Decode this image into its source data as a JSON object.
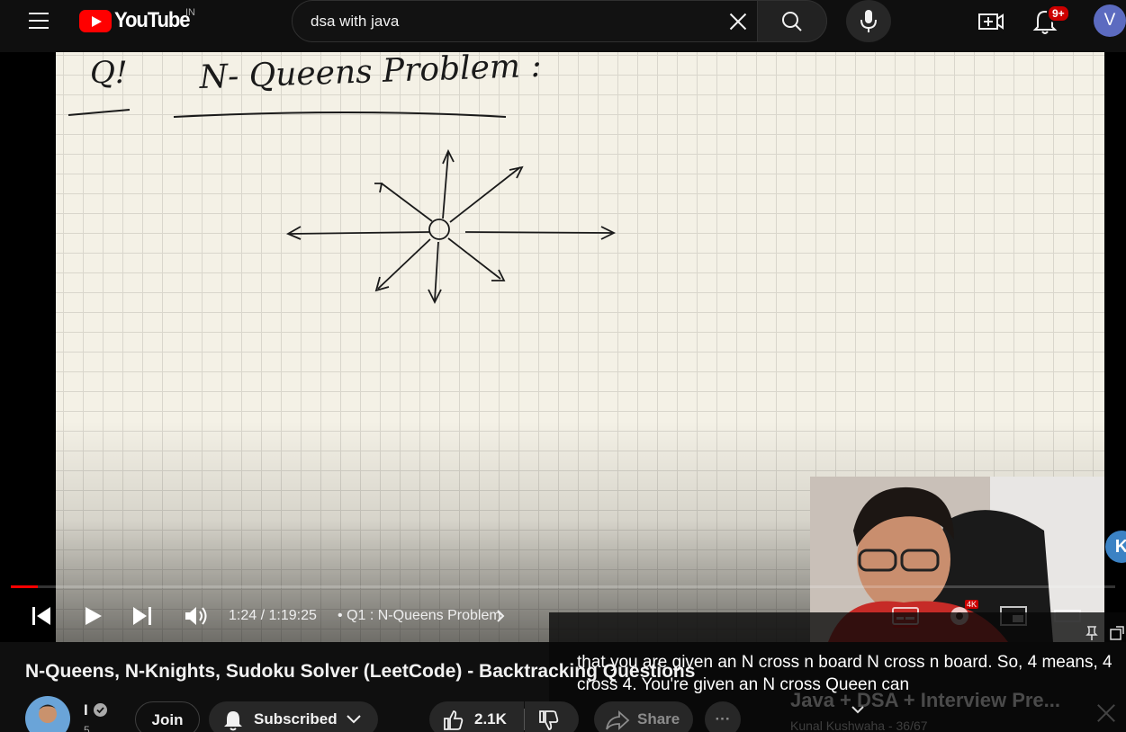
{
  "masthead": {
    "logo_text": "YouTube",
    "region": "IN",
    "search_value": "dsa with java",
    "notification_count": "9+",
    "avatar_letter": "V"
  },
  "whiteboard": {
    "label": "Q!",
    "heading": "N- Queens Problem :"
  },
  "player": {
    "time": "1:24 / 1:19:25",
    "chapter_separator": "•",
    "chapter": "Q1 : N-Queens Problem",
    "progress_fraction": 0.0018,
    "settings_badge": "4K",
    "side_badge_letter": "K"
  },
  "captions": {
    "text": "that you are given an N cross n board N cross n board. So, 4 means, 4\ncross 4. You're given an N cross Queen can"
  },
  "video": {
    "title": "N-Queens, N-Knights, Sudoku Solver (LeetCode) - Backtracking Questions",
    "channel_name": "I",
    "subscriber_count": "5",
    "join_label": "Join",
    "subscribed_label": "Subscribed",
    "likes": "2.1K",
    "share_label": "Share",
    "more_label": "···"
  },
  "playlist": {
    "title": "Java + DSA + Interview Pre...",
    "subtitle": "Kunal Kushwaha - 36/67"
  }
}
